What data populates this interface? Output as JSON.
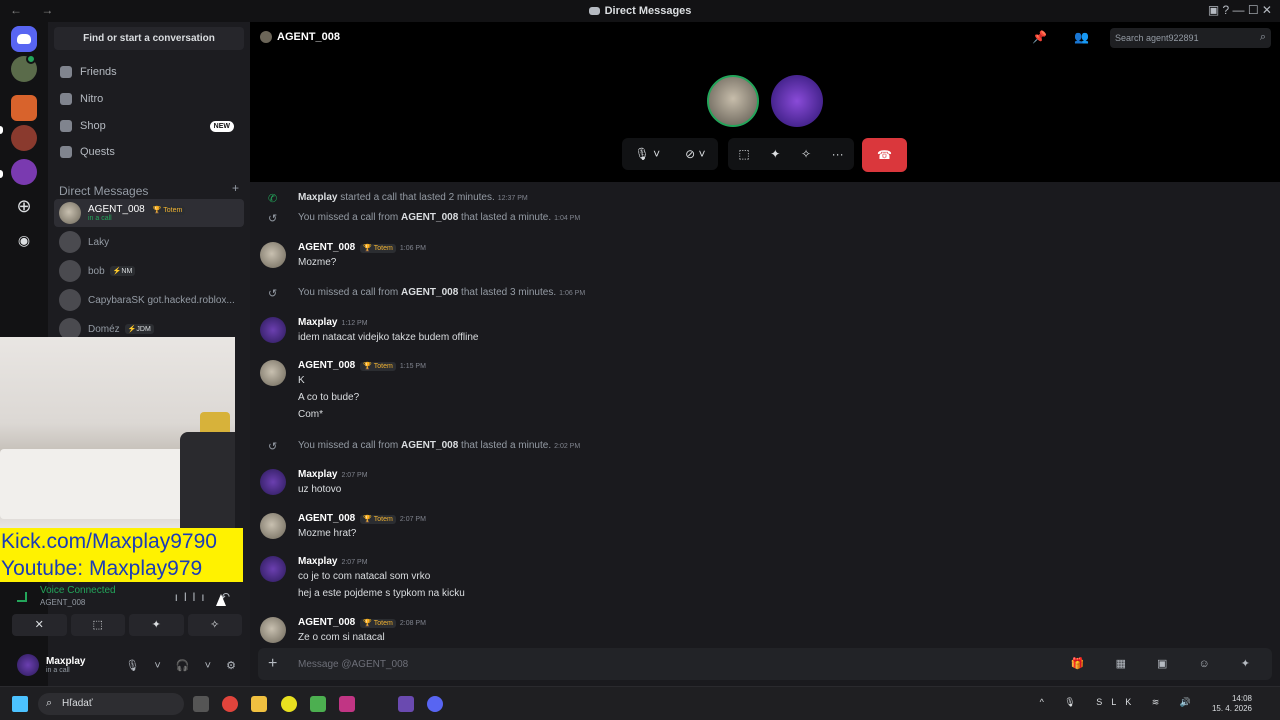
{
  "window": {
    "title": "Direct Messages",
    "nav": "← →",
    "controls": "▣ ? — ☐ ✕"
  },
  "dm_panel": {
    "find_label": "Find or start a conversation",
    "nav_items": [
      {
        "label": "Friends"
      },
      {
        "label": "Nitro"
      },
      {
        "label": "Shop",
        "badge": "NEW"
      },
      {
        "label": "Quests"
      }
    ],
    "section_header": "Direct Messages",
    "section_add": "+",
    "dms": [
      {
        "name": "AGENT_008",
        "tag": "🏆 Totem",
        "status": "in a call"
      },
      {
        "name": "Laky"
      },
      {
        "name": "bob",
        "tag": "⚡NM"
      },
      {
        "name": "CapybaraSK got.hacked.roblox..."
      },
      {
        "name": "Doméz",
        "tag": "⚡JDM"
      }
    ]
  },
  "overlay": {
    "line1": "Kick.com/Maxplay9790",
    "line2": "Youtube: Maxplay979"
  },
  "voice": {
    "status": "Voice Connected",
    "channel": "AGENT_008",
    "controls": "ıllı ↶",
    "buttons": [
      "✕",
      "⬚",
      "✦",
      "✧"
    ]
  },
  "user": {
    "name": "Maxplay",
    "status": "in a call",
    "controls": "🎙 ˅ 🎧 ˅ ⚙"
  },
  "header": {
    "name": "AGENT_008",
    "icons": "📌 👥 ◎",
    "search_placeholder": "Search agent922891",
    "search_icon": "⌕"
  },
  "call_bar": {
    "mic": "🎙 ˅",
    "video": "⊘ ˅",
    "screen": "⬚",
    "activity": "✦",
    "soundboard": "✧",
    "more": "···",
    "hangup": "☎"
  },
  "messages": [
    {
      "type": "sys",
      "icon": "✆",
      "author": "Maxplay",
      "text": " started a call that lasted 2 minutes.",
      "time": "12:37 PM"
    },
    {
      "type": "sys",
      "icon": "↺",
      "pre": "You missed a call from ",
      "author": "AGENT_008",
      "text": " that lasted a minute.",
      "time": "1:04 PM"
    },
    {
      "type": "msg",
      "author": "AGENT_008",
      "tag": "🏆 Totem",
      "time": "1:06 PM",
      "lines": [
        "Mozme?"
      ]
    },
    {
      "type": "sys",
      "icon": "↺",
      "pre": "You missed a call from ",
      "author": "AGENT_008",
      "text": " that lasted 3 minutes.",
      "time": "1:06 PM"
    },
    {
      "type": "msg",
      "author": "Maxplay",
      "time": "1:12 PM",
      "lines": [
        "idem natacat videjko takze budem offline"
      ]
    },
    {
      "type": "msg",
      "author": "AGENT_008",
      "tag": "🏆 Totem",
      "time": "1:15 PM",
      "lines": [
        "K",
        "A co to bude?",
        "Com*"
      ]
    },
    {
      "type": "sys",
      "icon": "↺",
      "pre": "You missed a call from ",
      "author": "AGENT_008",
      "text": " that lasted a minute.",
      "time": "2:02 PM"
    },
    {
      "type": "msg",
      "author": "Maxplay",
      "time": "2:07 PM",
      "lines": [
        "uz hotovo"
      ]
    },
    {
      "type": "msg",
      "author": "AGENT_008",
      "tag": "🏆 Totem",
      "time": "2:07 PM",
      "lines": [
        "Mozme hrat?"
      ]
    },
    {
      "type": "msg",
      "author": "Maxplay",
      "time": "2:07 PM",
      "lines": [
        "co je to com natacal som vrko",
        "hej a este pojdeme s typkom na kicku"
      ]
    },
    {
      "type": "msg",
      "author": "AGENT_008",
      "tag": "🏆 Totem",
      "time": "2:08 PM",
      "lines": [
        "Ze o com si natacal"
      ]
    }
  ],
  "composer": {
    "plus": "+",
    "placeholder": "Message @AGENT_008",
    "icons": "🎁 ▦ ▣ ☺ ✦"
  },
  "taskbar": {
    "search_label": "Hľadať",
    "search_icon": "⌕",
    "tray": "^ 🎙 SLK ≋ 🔊",
    "time": "14:08",
    "date": "15. 4. 2026"
  }
}
